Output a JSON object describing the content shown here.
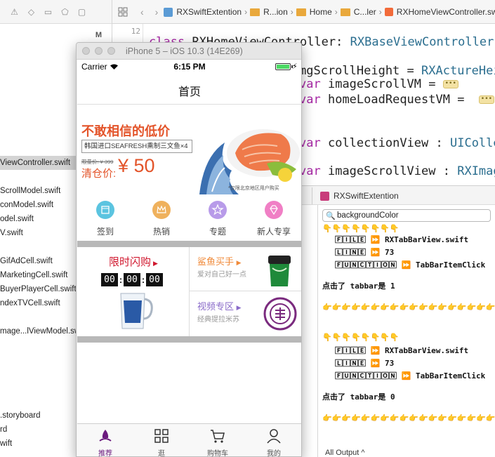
{
  "navigator": {
    "marker": "M",
    "items": [
      {
        "label": "ViewController.swift",
        "selected": true
      },
      {
        "label": "ScrollModel.swift"
      },
      {
        "label": "conModel.swift"
      },
      {
        "label": "odel.swift"
      },
      {
        "label": "V.swift"
      },
      {
        "label": "GifAdCell.swift"
      },
      {
        "label": "MarketingCell.swift"
      },
      {
        "label": "BuyerPlayerCell.swift"
      },
      {
        "label": "ndexTVCell.swift"
      },
      {
        "label": "mage...lViewModel.swift"
      },
      {
        "label": ".storyboard"
      },
      {
        "label": "rd"
      },
      {
        "label": "wift"
      }
    ]
  },
  "jump_bar": {
    "project": "RXSwiftExtention",
    "folder1": "R...ion",
    "folder2": "Home",
    "folder3": "C...ler",
    "file": "RXHomeViewController.swift"
  },
  "code": {
    "line_number": "12",
    "lines": {
      "l1_kw": "class",
      "l1_name": "RXHomeViewController:",
      "l1_super": "RXBaseViewController",
      "l2_name": "mgScrollHeight =",
      "l2_type": "RXActureHei",
      "l3_kw": "var",
      "l3_name": "imageScrollVM =",
      "l4_kw": "var",
      "l4_name": "homeLoadRequestVM =",
      "l5_kw": "var",
      "l5_name": "collectionView :",
      "l5_type": "UIColle",
      "l6_kw": "var",
      "l6_name": "imageScrollView :",
      "l6_type": "RXImag"
    }
  },
  "debug": {
    "project": "RXSwiftExtention",
    "search_value": "backgroundColor",
    "output_label": "All Output ^",
    "lines": {
      "emoji_top": "👇👇👇👇👇👇👇👇",
      "file1": "🄵🄸🄻🄴 ⏩ RXTabBarView.swift",
      "line1": "🄻🄸🄽🄴 ⏩ 73",
      "func1": "🄵🅄🄽🄲🅃🄸🄾🄽 ⏩ TabBarItemClick",
      "msg1": "点击了 tabbar是 1",
      "emoji_mid": "👉👉👉👉👉👉👉👉👉👉👉👉👉👉👉👉👉👉👉👉",
      "emoji_down": "👇👇👇👇👇👇👇👇",
      "file2": "🄵🄸🄻🄴 ⏩ RXTabBarView.swift",
      "line2": "🄻🄸🄽🄴 ⏩ 73",
      "func2": "🄵🅄🄽🄲🅃🄸🄾🄽 ⏩ TabBarItemClick",
      "msg2": "点击了 tabbar是 0",
      "emoji_bot": "👉👉👉👉👉👉👉👉👉👉👉👉👉👉👉👉👉👉👉👉"
    }
  },
  "simulator": {
    "window_title": "iPhone 5 – iOS 10.3 (14E269)",
    "status": {
      "carrier": "Carrier",
      "time": "6:15 PM"
    },
    "nav_title": "首页",
    "banner": {
      "headline": "不敢相信的低价",
      "product": "韩国进口SEAFRESH熏制三文鱼×4",
      "original_price": "限量价: ¥ 399",
      "clearance_label": "清仓价:",
      "price": "¥ 50",
      "note": "*仅限北京地区用户购买"
    },
    "categories": [
      {
        "label": "签到",
        "color": "#5bc4e0"
      },
      {
        "label": "热销",
        "color": "#efb15d"
      },
      {
        "label": "专题",
        "color": "#b89be9"
      },
      {
        "label": "新人专享",
        "color": "#f07fc5"
      }
    ],
    "flash_sale": {
      "title": "限时闪购",
      "hh": "00",
      "mm": "00",
      "ss": "00"
    },
    "promos": [
      {
        "title": "鲨鱼买手",
        "subtitle": "爱对自己好一点",
        "color": "#f08a3a"
      },
      {
        "title": "视频专区",
        "subtitle": "经典提拉米苏",
        "color": "#8a6bc9"
      }
    ],
    "tabs": [
      {
        "label": "推荐",
        "active": true
      },
      {
        "label": "逛"
      },
      {
        "label": "购物车"
      },
      {
        "label": "我的"
      }
    ],
    "accent": "#6b1a7e"
  }
}
